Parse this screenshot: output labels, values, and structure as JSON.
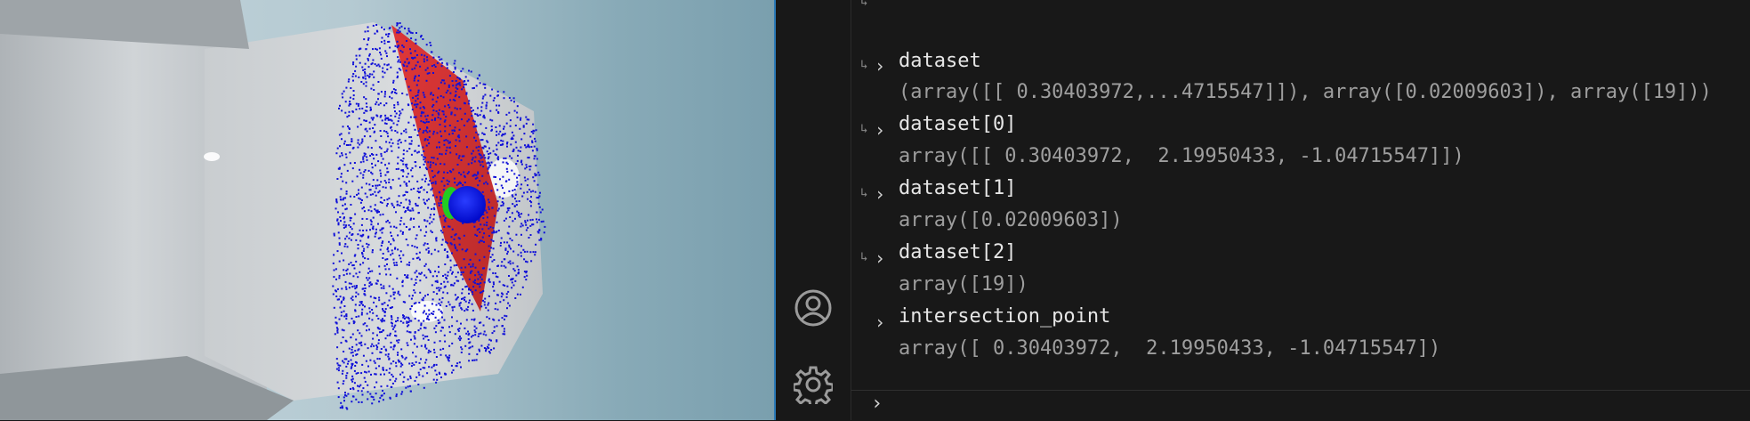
{
  "viewport": {
    "label": "3D point cloud viewer"
  },
  "activity_bar": {
    "items": [
      {
        "icon": "account-icon"
      },
      {
        "icon": "gear-icon"
      }
    ]
  },
  "console": {
    "entries": [
      {
        "expression": "dataset",
        "result": "(array([[ 0.30403972,...4715547]]), array([0.02009603]), array([19]))"
      },
      {
        "expression": "dataset[0]",
        "result": "array([[ 0.30403972,  2.19950433, -1.04715547]])"
      },
      {
        "expression": "dataset[1]",
        "result": "array([0.02009603])"
      },
      {
        "expression": "dataset[2]",
        "result": "array([19])"
      },
      {
        "expression": "intersection_point",
        "result": "array([ 0.30403972,  2.19950433, -1.04715547])"
      }
    ],
    "prompt_arrow": "↳",
    "expand_chevron": "›",
    "input_chevron": "›"
  },
  "colors": {
    "points": "#1010d8",
    "plane": "#d42424",
    "sphere": "#0a14f0",
    "marker": "#22cc22",
    "panel_bg": "#181818",
    "divider": "#2a7ab8"
  }
}
